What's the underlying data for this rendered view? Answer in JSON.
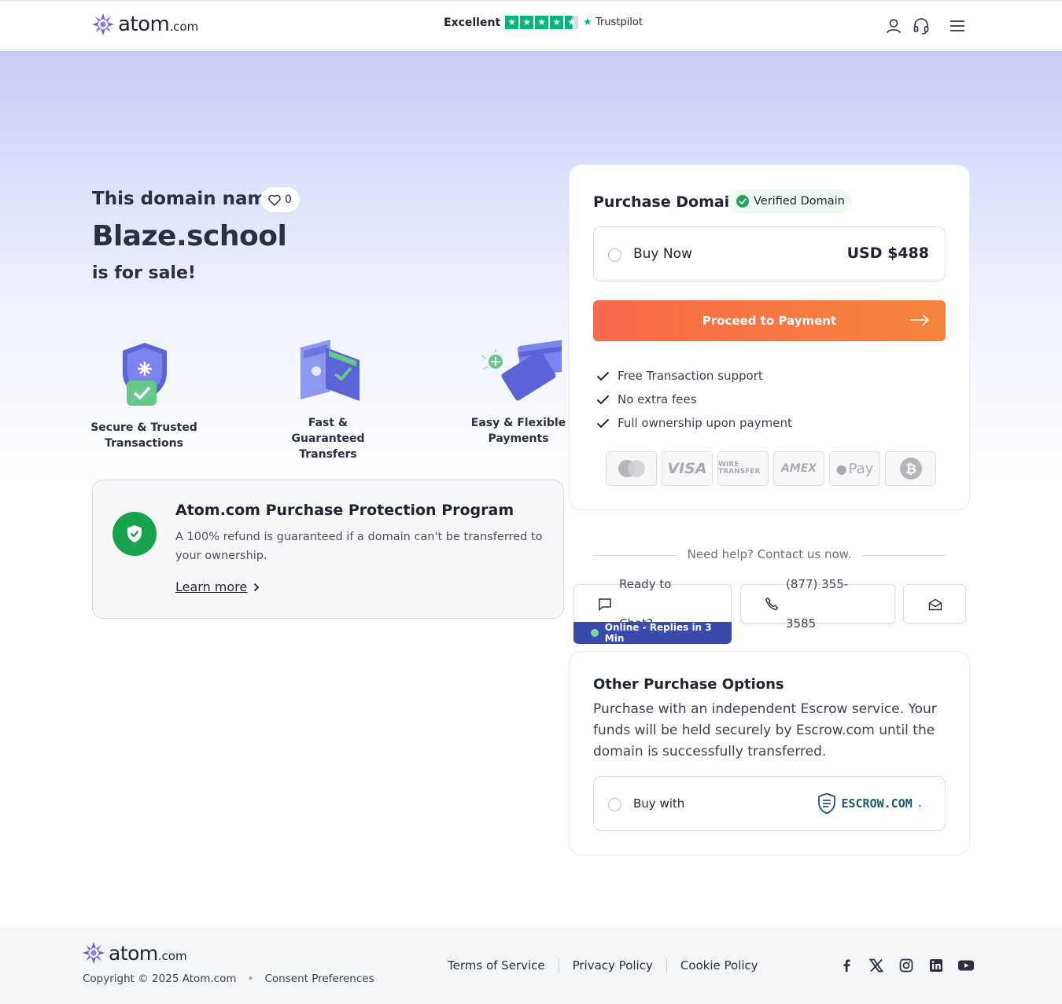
{
  "header": {
    "logo_text": "atom",
    "logo_tld": ".com",
    "trust_label": "Excellent",
    "trust_brand": "Trustpilot",
    "rating_stars": 4.5
  },
  "hero": {
    "label": "This domain name",
    "favorites_count": "0",
    "domain": "Blaze.school",
    "for_sale": "is for sale!"
  },
  "features": [
    {
      "line1": "Secure & Trusted",
      "line2": "Transactions"
    },
    {
      "line1": "Fast & Guaranteed",
      "line2": "Transfers"
    },
    {
      "line1": "Easy & Flexible",
      "line2": "Payments"
    }
  ],
  "protection": {
    "title": "Atom.com Purchase Protection Program",
    "description": "A 100% refund is guaranteed if a domain can't be transferred to your ownership.",
    "link": "Learn more"
  },
  "purchase": {
    "title": "Purchase Domain",
    "badge": "Verified Domain",
    "option_label": "Buy Now",
    "price": "USD $488",
    "cta": "Proceed to Payment",
    "benefits": [
      "Free Transaction support",
      "No extra fees",
      "Full ownership upon payment"
    ],
    "payment_methods": [
      "mastercard",
      "VISA",
      "WIRE TRANSFER",
      "AMEX",
      "Pay",
      "bitcoin"
    ]
  },
  "help": {
    "text": "Need help? Contact us now.",
    "chat_label": "Ready to Chat?",
    "chat_status": "Online - Replies in 3 Min",
    "phone": "(877) 355-3585"
  },
  "other": {
    "title": "Other Purchase Options",
    "description": "Purchase with an independent Escrow service. Your funds will be held securely by Escrow.com until the domain is successfully transferred.",
    "option_label": "Buy with",
    "escrow_brand": "ESCROW.COM"
  },
  "footer": {
    "copyright": "Copyright © 2025 Atom.com",
    "consent": "Consent Preferences",
    "links": [
      "Terms of Service",
      "Privacy Policy",
      "Cookie Policy"
    ],
    "social": [
      "facebook-icon",
      "x-icon",
      "instagram-icon",
      "linkedin-icon",
      "youtube-icon"
    ]
  },
  "colors": {
    "accent": "#fb6a4a",
    "brand": "#5b5ce8",
    "success": "#16a34a",
    "trustpilot": "#00b67a"
  }
}
